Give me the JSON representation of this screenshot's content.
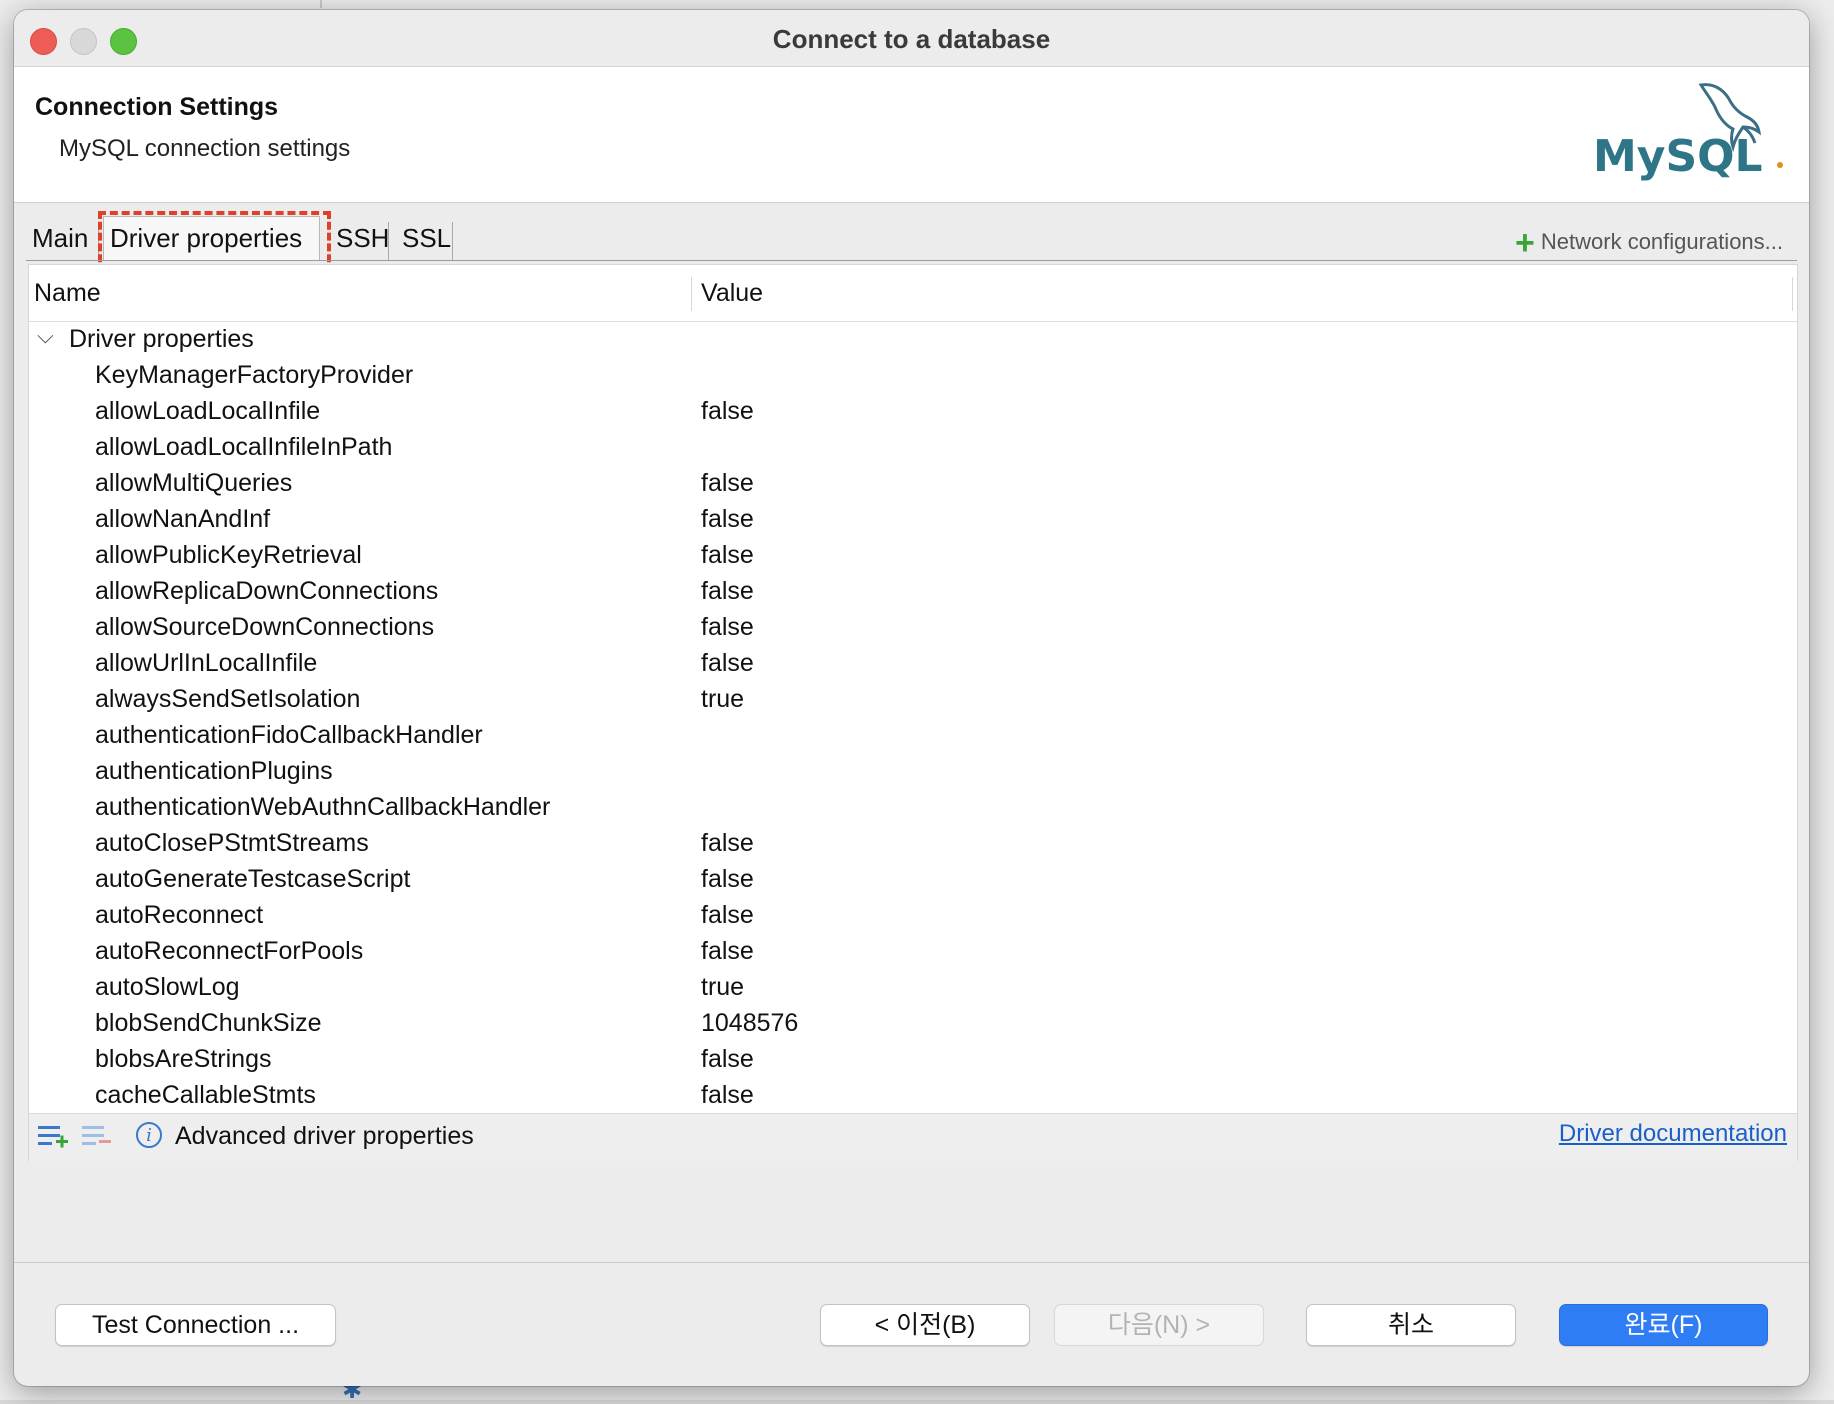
{
  "window": {
    "title": "Connect to a database"
  },
  "header": {
    "title": "Connection Settings",
    "subtitle": "MySQL connection settings",
    "logo_text": "MySQL"
  },
  "tabs": [
    {
      "label": "Main"
    },
    {
      "label": "Driver properties",
      "active": true
    },
    {
      "label": "SSH"
    },
    {
      "label": "SSL"
    }
  ],
  "network_configurations": "Network configurations...",
  "table": {
    "columns": {
      "name": "Name",
      "value": "Value"
    },
    "group_label": "Driver properties",
    "rows": [
      {
        "name": "KeyManagerFactoryProvider",
        "value": ""
      },
      {
        "name": "allowLoadLocalInfile",
        "value": "false"
      },
      {
        "name": "allowLoadLocalInfileInPath",
        "value": ""
      },
      {
        "name": "allowMultiQueries",
        "value": "false"
      },
      {
        "name": "allowNanAndInf",
        "value": "false"
      },
      {
        "name": "allowPublicKeyRetrieval",
        "value": "false"
      },
      {
        "name": "allowReplicaDownConnections",
        "value": "false"
      },
      {
        "name": "allowSourceDownConnections",
        "value": "false"
      },
      {
        "name": "allowUrlInLocalInfile",
        "value": "false"
      },
      {
        "name": "alwaysSendSetIsolation",
        "value": "true"
      },
      {
        "name": "authenticationFidoCallbackHandler",
        "value": ""
      },
      {
        "name": "authenticationPlugins",
        "value": ""
      },
      {
        "name": "authenticationWebAuthnCallbackHandler",
        "value": ""
      },
      {
        "name": "autoClosePStmtStreams",
        "value": "false"
      },
      {
        "name": "autoGenerateTestcaseScript",
        "value": "false"
      },
      {
        "name": "autoReconnect",
        "value": "false"
      },
      {
        "name": "autoReconnectForPools",
        "value": "false"
      },
      {
        "name": "autoSlowLog",
        "value": "true"
      },
      {
        "name": "blobSendChunkSize",
        "value": "1048576"
      },
      {
        "name": "blobsAreStrings",
        "value": "false"
      },
      {
        "name": "cacheCallableStmts",
        "value": "false"
      }
    ]
  },
  "panel_footer": {
    "advanced_label": "Advanced driver properties",
    "doc_link": "Driver documentation"
  },
  "buttons": {
    "test": "Test Connection ...",
    "prev": "< 이전(B)",
    "next": "다음(N) >",
    "cancel": "취소",
    "finish": "완료(F)"
  },
  "colors": {
    "accent": "#2f7df5",
    "highlight": "#e0402a",
    "link": "#1a5fc8"
  }
}
